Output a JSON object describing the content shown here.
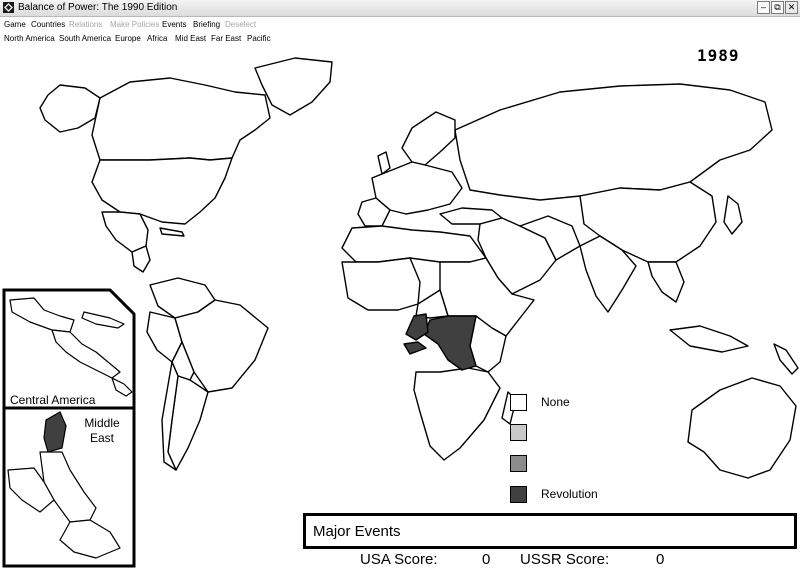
{
  "window": {
    "title": "Balance of Power: The 1990 Edition",
    "minimize_glyph": "–",
    "restore_glyph": "⧉",
    "close_glyph": "✕",
    "app_icon": "diamond-grid-icon"
  },
  "menu": {
    "items": [
      {
        "label": "Game",
        "enabled": true
      },
      {
        "label": "Countries",
        "enabled": true
      },
      {
        "label": "Relations",
        "enabled": false
      },
      {
        "label": "Make Policies",
        "enabled": false
      },
      {
        "label": "Events",
        "enabled": true
      },
      {
        "label": "Briefing",
        "enabled": true
      },
      {
        "label": "Deselect",
        "enabled": false
      }
    ]
  },
  "regions": {
    "items": [
      "North America",
      "South America",
      "Europe",
      "Africa",
      "Mid East",
      "Far East",
      "Pacific"
    ]
  },
  "map": {
    "year": "1989",
    "insets": {
      "central_america": "Central America",
      "middle_east": [
        "Middle",
        "East"
      ]
    }
  },
  "legend": {
    "items": [
      {
        "label": "None",
        "color": "#ffffff"
      },
      {
        "label": "",
        "color": "#c8c8c8"
      },
      {
        "label": "",
        "color": "#8c8c8c"
      },
      {
        "label": "Revolution",
        "color": "#404040"
      }
    ]
  },
  "events": {
    "title": "Major Events"
  },
  "scores": {
    "usa_label": "USA Score:",
    "usa_value": "0",
    "ussr_label": "USSR Score:",
    "ussr_value": "0"
  }
}
